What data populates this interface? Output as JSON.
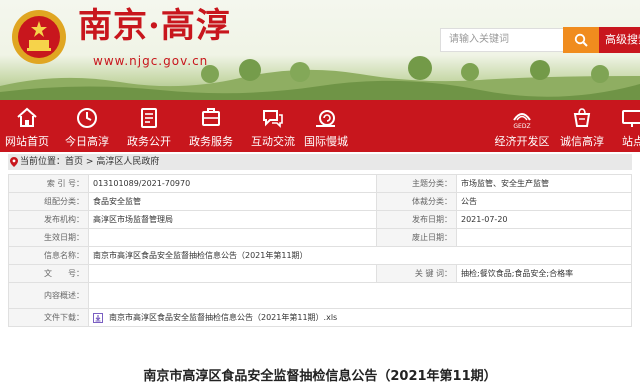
{
  "header": {
    "site_title": "南京·高淳",
    "site_url": "www.njgc.gov.cn",
    "search_placeholder": "请输入关键词",
    "advanced_search": "高级搜索"
  },
  "nav": {
    "items": [
      {
        "label": "网站首页",
        "icon": "home-icon"
      },
      {
        "label": "今日高淳",
        "icon": "clock-icon"
      },
      {
        "label": "政务公开",
        "icon": "document-icon"
      },
      {
        "label": "政务服务",
        "icon": "service-icon"
      },
      {
        "label": "互动交流",
        "icon": "chat-icon"
      },
      {
        "label": "国际慢城",
        "icon": "snail-icon"
      },
      {
        "label": "经济开发区",
        "icon": "gedz-logo-icon"
      },
      {
        "label": "诚信高淳",
        "icon": "credit-icon"
      },
      {
        "label": "站点",
        "icon": "site-icon"
      }
    ],
    "gedz_text": "GEDZ"
  },
  "breadcrumb": {
    "prefix": "当前位置：",
    "home": "首页",
    "sep": ">",
    "current": "高淳区人民政府"
  },
  "info": {
    "index_label": "索 引 号：",
    "index_value": "013101089/2021-70970",
    "subject_label": "主题分类：",
    "subject_value": "市场监管、安全生产监管",
    "org_label": "组配分类：",
    "org_value": "食品安全监管",
    "genre_label": "体裁分类：",
    "genre_value": "公告",
    "publisher_label": "发布机构：",
    "publisher_value": "高淳区市场监督管理局",
    "date_label": "发布日期：",
    "date_value": "2021-07-20",
    "effective_label": "生效日期：",
    "effective_value": "",
    "repeal_label": "废止日期：",
    "repeal_value": "",
    "name_label": "信息名称：",
    "name_value": "南京市高淳区食品安全监督抽检信息公告（2021年第11期）",
    "docno_label": "文　　号：",
    "docno_value": "",
    "keywords_label": "关 键 词：",
    "keywords_value": "抽检;餐饮食品;食品安全;合格率",
    "summary_label": "内容概述：",
    "summary_value": "",
    "download_label": "文件下载：",
    "download_value": "南京市高淳区食品安全监督抽检信息公告（2021年第11期）.xls"
  },
  "article": {
    "title": "南京市高淳区食品安全监督抽检信息公告（2021年第11期）"
  },
  "colors": {
    "brand_red": "#c8161d",
    "search_orange": "#f08c1e"
  }
}
